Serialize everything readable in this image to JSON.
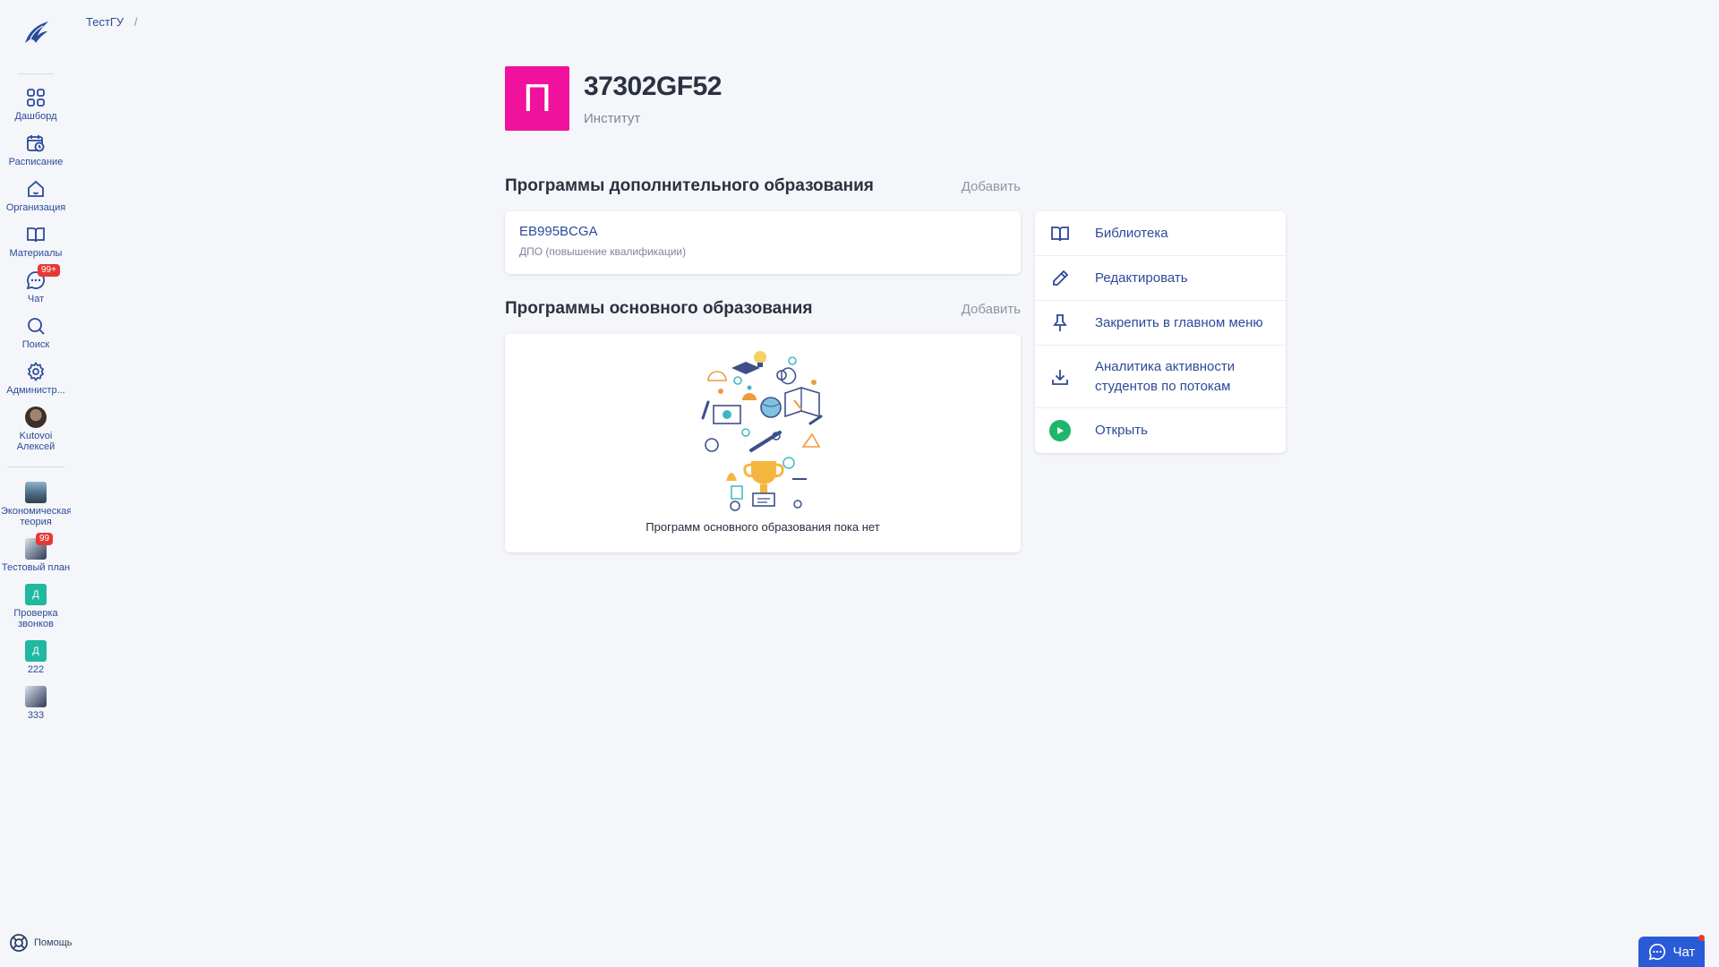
{
  "breadcrumb": {
    "root": "ТестГУ",
    "separator": "/"
  },
  "sidebar": {
    "items": [
      {
        "label": "Дашборд"
      },
      {
        "label": "Расписание"
      },
      {
        "label": "Организация"
      },
      {
        "label": "Материалы"
      },
      {
        "label": "Чат",
        "badge": "99+"
      },
      {
        "label": "Поиск"
      },
      {
        "label": "Администр..."
      },
      {
        "label": "Kutovoi Алексей"
      }
    ],
    "courses": [
      {
        "label": "Экономическая теория"
      },
      {
        "label": "Тестовый план",
        "badge": "99"
      },
      {
        "label": "Проверка звонков",
        "initial": "Д"
      },
      {
        "label": "222",
        "initial": "Д"
      },
      {
        "label": "333"
      }
    ],
    "help_label": "Помощь"
  },
  "org": {
    "initial": "П",
    "title": "37302GF52",
    "subtitle": "Институт",
    "avatar_color": "#f0129c"
  },
  "extra_programs": {
    "title": "Программы дополнительного образования",
    "add_label": "Добавить",
    "items": [
      {
        "code": "EB995BCGA",
        "type": "ДПО (повышение квалификации)"
      }
    ]
  },
  "main_programs": {
    "title": "Программы основного образования",
    "add_label": "Добавить",
    "empty_text": "Программ основного образования пока нет"
  },
  "actions": [
    {
      "label": "Библиотека",
      "icon": "book-icon"
    },
    {
      "label": "Редактировать",
      "icon": "pencil-icon"
    },
    {
      "label": "Закрепить в главном меню",
      "icon": "pin-icon"
    },
    {
      "label": "Аналитика активности студентов по потокам",
      "icon": "download-icon"
    },
    {
      "label": "Открыть",
      "icon": "play-icon"
    }
  ],
  "chat_float": {
    "label": "Чат"
  },
  "colors": {
    "accent": "#2c4a9a",
    "brand_button": "#2a5bd7",
    "badge": "#e53935",
    "open": "#1db66a"
  }
}
